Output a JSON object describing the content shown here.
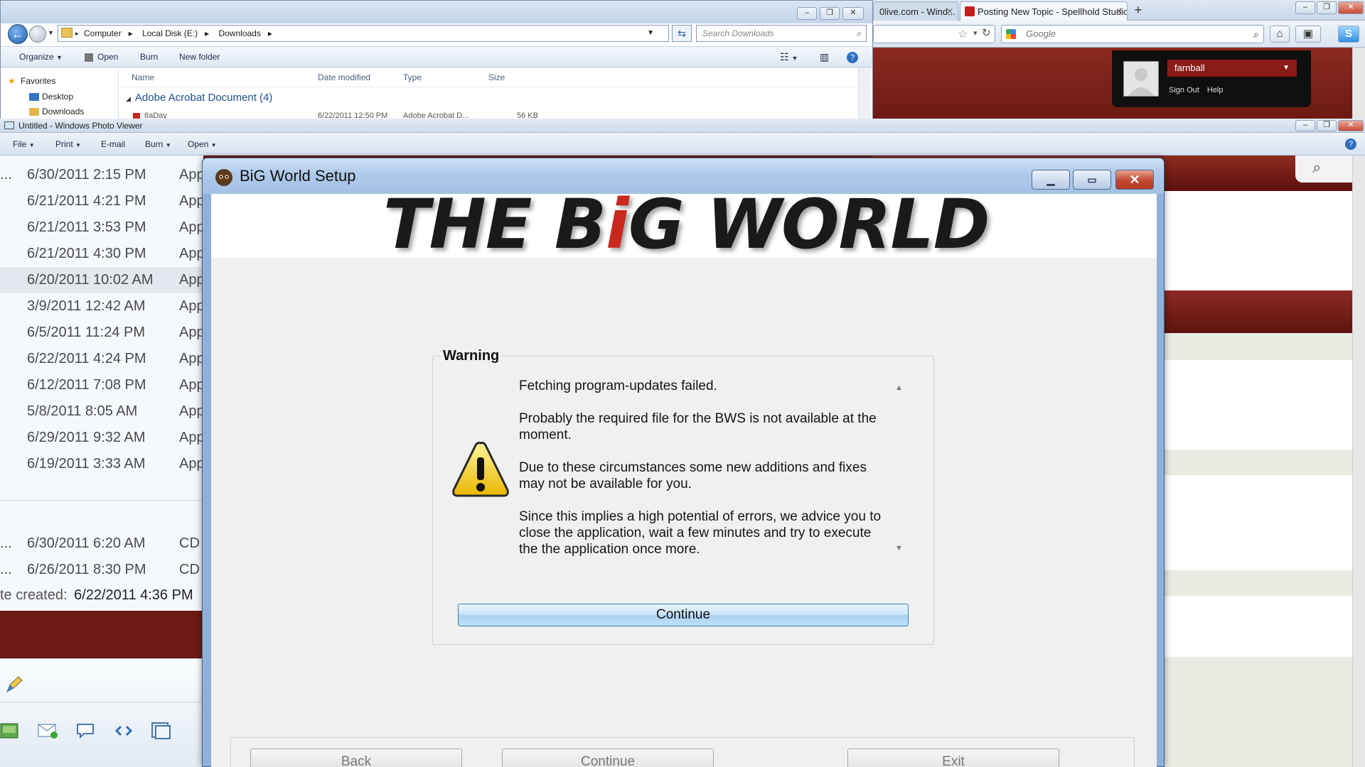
{
  "firefox": {
    "tabs": [
      {
        "label": "0live.com - Wind..."
      },
      {
        "label": "Posting New Topic - Spellhold Studios"
      }
    ],
    "search_placeholder": "Google",
    "user": {
      "name": "farnball",
      "links": [
        "Sign Out",
        "Help"
      ]
    }
  },
  "explorer": {
    "breadcrumb": [
      "Computer",
      "Local Disk (E:)",
      "Downloads"
    ],
    "search_placeholder": "Search Downloads",
    "toolbar": [
      "Organize",
      "Open",
      "Burn",
      "New folder"
    ],
    "nav": [
      "Favorites",
      "Desktop",
      "Downloads"
    ],
    "columns": [
      "Name",
      "Date modified",
      "Type",
      "Size"
    ],
    "group_header": "Adobe Acrobat Document (4)",
    "partial_row": {
      "name": "8aDay",
      "date": "6/22/2011 12:50 PM",
      "type": "Adobe Acrobat D...",
      "size": "56 KB"
    }
  },
  "photo_viewer": {
    "title": "Untitled - Windows Photo Viewer",
    "menu": [
      "File",
      "Print",
      "E-mail",
      "Burn",
      "Open"
    ],
    "rows": [
      {
        "prefix": "...",
        "date": "6/30/2011 2:15 PM",
        "type": "App"
      },
      {
        "prefix": "",
        "date": "6/21/2011 4:21 PM",
        "type": "App"
      },
      {
        "prefix": "",
        "date": "6/21/2011 3:53 PM",
        "type": "App"
      },
      {
        "prefix": "",
        "date": "6/21/2011 4:30 PM",
        "type": "App"
      },
      {
        "prefix": "",
        "date": "6/20/2011 10:02 AM",
        "type": "App"
      },
      {
        "prefix": "",
        "date": "3/9/2011 12:42 AM",
        "type": "App"
      },
      {
        "prefix": "",
        "date": "6/5/2011 11:24 PM",
        "type": "App"
      },
      {
        "prefix": "",
        "date": "6/22/2011 4:24 PM",
        "type": "App"
      },
      {
        "prefix": "",
        "date": "6/12/2011 7:08 PM",
        "type": "App"
      },
      {
        "prefix": "",
        "date": "5/8/2011 8:05 AM",
        "type": "App"
      },
      {
        "prefix": "",
        "date": "6/29/2011 9:32 AM",
        "type": "App"
      },
      {
        "prefix": "",
        "date": "6/19/2011 3:33 AM",
        "type": "App"
      }
    ],
    "rows2": [
      {
        "prefix": "...",
        "date": "6/30/2011 6:20 AM",
        "type": "CD"
      },
      {
        "prefix": "...",
        "date": "6/26/2011 8:30 PM",
        "type": "CD"
      }
    ],
    "date_created_label": "te created:",
    "date_created_value": "6/22/2011 4:36 PM"
  },
  "setup": {
    "title": "BiG World Setup",
    "logo": {
      "pre": "THE B",
      "i": "i",
      "post": "G WORLD"
    },
    "group_title": "Warning",
    "messages": [
      "Fetching program-updates failed.",
      "Probably the required file for the BWS is not available at the moment.",
      "Due to these circumstances some new additions and fixes may not be available for you.",
      "Since this implies a high potential of errors, we advice you to close the application, wait a few minutes and try to execute the the application once more."
    ],
    "continue_label": "Continue",
    "buttons": {
      "back": "Back",
      "continue": "Continue",
      "exit": "Exit"
    }
  }
}
